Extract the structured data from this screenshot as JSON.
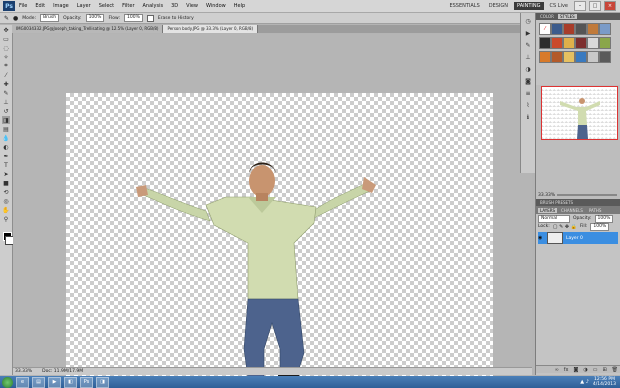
{
  "menubar": {
    "logo": "Ps",
    "items": [
      "File",
      "Edit",
      "Image",
      "Layer",
      "Select",
      "Filter",
      "Analysis",
      "3D",
      "View",
      "Window",
      "Help"
    ],
    "workspaces": [
      "ESSENTIALS",
      "DESIGN",
      "PAINTING"
    ],
    "active_workspace": "PAINTING",
    "cslive": "CS Live"
  },
  "options": {
    "mode_label": "Mode:",
    "mode_value": "Brush",
    "opacity_label": "Opacity:",
    "opacity_value": "100%",
    "flow_label": "Flow:",
    "flow_value": "100%",
    "erase_history": "Erase to History"
  },
  "tabs": [
    {
      "label": "IMG0034332.JPG@Joseph_taking_Trellisating @ 12.5% (Layer 0, RGB/8)"
    },
    {
      "label": "Person body.JPG @ 33.3% (Layer 0, RGB/8)"
    }
  ],
  "status": {
    "zoom": "33.33%",
    "doc": "Doc: 11.9M/17.9M"
  },
  "panels": {
    "swatch_tabs": [
      "COLOR",
      "STYLES"
    ],
    "active_swatch_tab": "STYLES",
    "nav_zoom": "33.33%",
    "brush_presets": "BRUSH PRESETS",
    "layer_tabs": [
      "LAYERS",
      "CHANNELS",
      "PATHS"
    ],
    "blend_mode": "Normal",
    "opacity_label": "Opacity:",
    "opacity_value": "100%",
    "lock_label": "Lock:",
    "fill_label": "Fill:",
    "fill_value": "100%",
    "layer_name": "Layer 0"
  },
  "taskbar": {
    "time": "12:56 PM",
    "date": "4/14/2013"
  },
  "colors": {
    "accent": "#3b8ee1",
    "foreground": "#000000",
    "background": "#ffffff"
  }
}
